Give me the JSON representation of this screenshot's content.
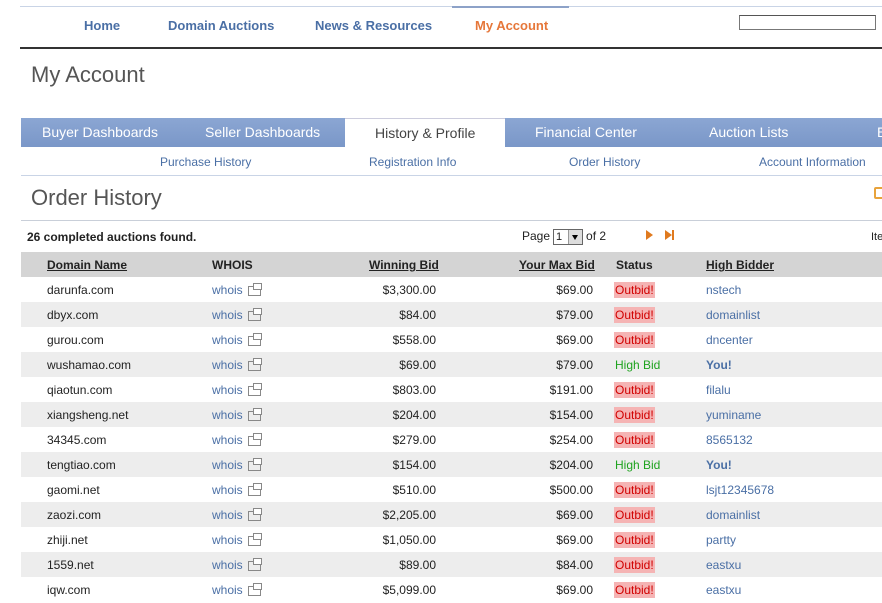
{
  "topnav": {
    "home": "Home",
    "domain_auctions": "Domain Auctions",
    "news": "News & Resources",
    "my_account": "My Account",
    "search_value": ""
  },
  "page_title": "My Account",
  "tabs": [
    "Buyer Dashboards",
    "Seller Dashboards",
    "History & Profile",
    "Financial Center",
    "Auction Lists",
    "E"
  ],
  "subnav": [
    "Purchase History",
    "Registration Info",
    "Order History",
    "Account Information"
  ],
  "section_title": "Order History",
  "found_text": "26 completed auctions found.",
  "pager": {
    "page_label": "Page",
    "page_value": "1",
    "of_label": "of 2"
  },
  "items_label": "Ite",
  "table": {
    "headers": [
      "Domain Name",
      "WHOIS",
      "Winning Bid",
      "Your Max Bid",
      "Status",
      "High Bidder"
    ],
    "rows": [
      {
        "domain": "darunfa.com",
        "whois": "whois",
        "win": "$3,300.00",
        "max": "$69.00",
        "status": "Outbid!",
        "bidder": "nstech"
      },
      {
        "domain": "dbyx.com",
        "whois": "whois",
        "win": "$84.00",
        "max": "$79.00",
        "status": "Outbid!",
        "bidder": "domainlist"
      },
      {
        "domain": "gurou.com",
        "whois": "whois",
        "win": "$558.00",
        "max": "$69.00",
        "status": "Outbid!",
        "bidder": "dncenter"
      },
      {
        "domain": "wushamao.com",
        "whois": "whois",
        "win": "$69.00",
        "max": "$79.00",
        "status": "High Bid",
        "bidder": "You!"
      },
      {
        "domain": "qiaotun.com",
        "whois": "whois",
        "win": "$803.00",
        "max": "$191.00",
        "status": "Outbid!",
        "bidder": "filalu"
      },
      {
        "domain": "xiangsheng.net",
        "whois": "whois",
        "win": "$204.00",
        "max": "$154.00",
        "status": "Outbid!",
        "bidder": "yuminame"
      },
      {
        "domain": "34345.com",
        "whois": "whois",
        "win": "$279.00",
        "max": "$254.00",
        "status": "Outbid!",
        "bidder": "8565132"
      },
      {
        "domain": "tengtiao.com",
        "whois": "whois",
        "win": "$154.00",
        "max": "$204.00",
        "status": "High Bid",
        "bidder": "You!"
      },
      {
        "domain": "gaomi.net",
        "whois": "whois",
        "win": "$510.00",
        "max": "$500.00",
        "status": "Outbid!",
        "bidder": "lsjt12345678"
      },
      {
        "domain": "zaozi.com",
        "whois": "whois",
        "win": "$2,205.00",
        "max": "$69.00",
        "status": "Outbid!",
        "bidder": "domainlist"
      },
      {
        "domain": "zhiji.net",
        "whois": "whois",
        "win": "$1,050.00",
        "max": "$69.00",
        "status": "Outbid!",
        "bidder": "partty"
      },
      {
        "domain": "1559.net",
        "whois": "whois",
        "win": "$89.00",
        "max": "$84.00",
        "status": "Outbid!",
        "bidder": "eastxu"
      },
      {
        "domain": "iqw.com",
        "whois": "whois",
        "win": "$5,099.00",
        "max": "$69.00",
        "status": "Outbid!",
        "bidder": "eastxu"
      }
    ]
  },
  "colors": {
    "accent": "#e6773a",
    "link": "#4a6fa5",
    "tab_bar": "#7a97c8",
    "outbid_bg": "#f5b4b4",
    "high_bid": "#1fa31f"
  }
}
